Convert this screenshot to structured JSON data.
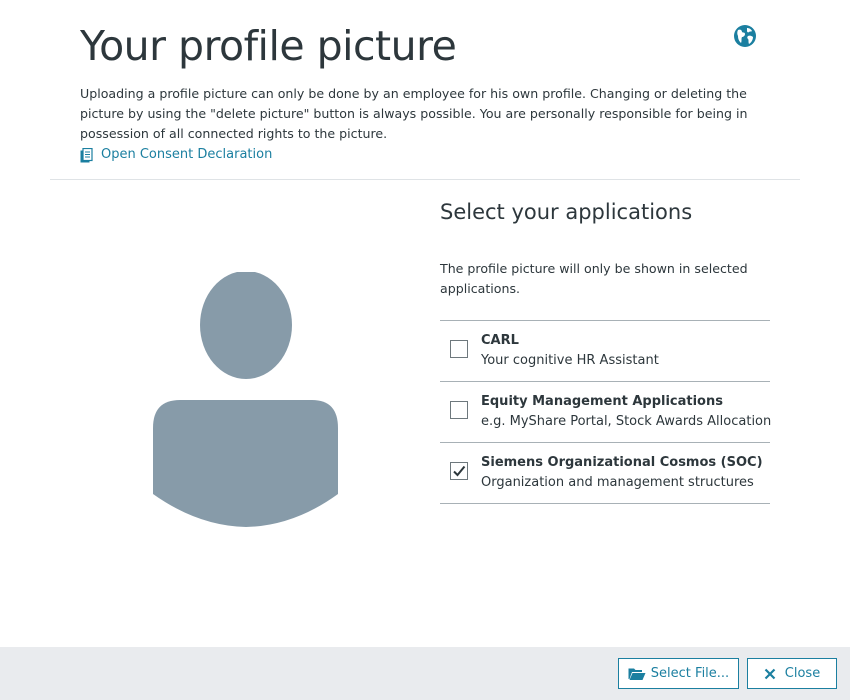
{
  "header": {
    "title": "Your profile picture",
    "globe_icon": "globe-icon",
    "description": "Uploading a profile picture can only be done by an employee for his own profile. Changing or deleting the picture by using the \"delete picture\" button is always possible. You are personally responsible for being in possession of all connected rights to the picture.",
    "consent_link": "Open Consent Declaration",
    "consent_icon": "document-icon"
  },
  "profile": {
    "avatar_icon": "person-silhouette-icon"
  },
  "applications": {
    "title": "Select your applications",
    "description": "The profile picture will only be shown in selected applications.",
    "items": [
      {
        "name": "CARL",
        "subtitle": "Your cognitive HR Assistant",
        "checked": false
      },
      {
        "name": "Equity Management Applications",
        "subtitle": "e.g. MyShare Portal, Stock Awards Allocation",
        "checked": false
      },
      {
        "name": "Siemens Organizational Cosmos (SOC)",
        "subtitle": "Organization and management structures",
        "checked": true
      }
    ]
  },
  "footer": {
    "select_file_label": "Select File...",
    "select_file_icon": "folder-open-icon",
    "close_label": "Close",
    "close_icon": "close-icon"
  },
  "colors": {
    "accent": "#1b7fa0",
    "text": "#2d373c",
    "avatar": "#879ba9",
    "footer_bg": "#e9ebee"
  }
}
